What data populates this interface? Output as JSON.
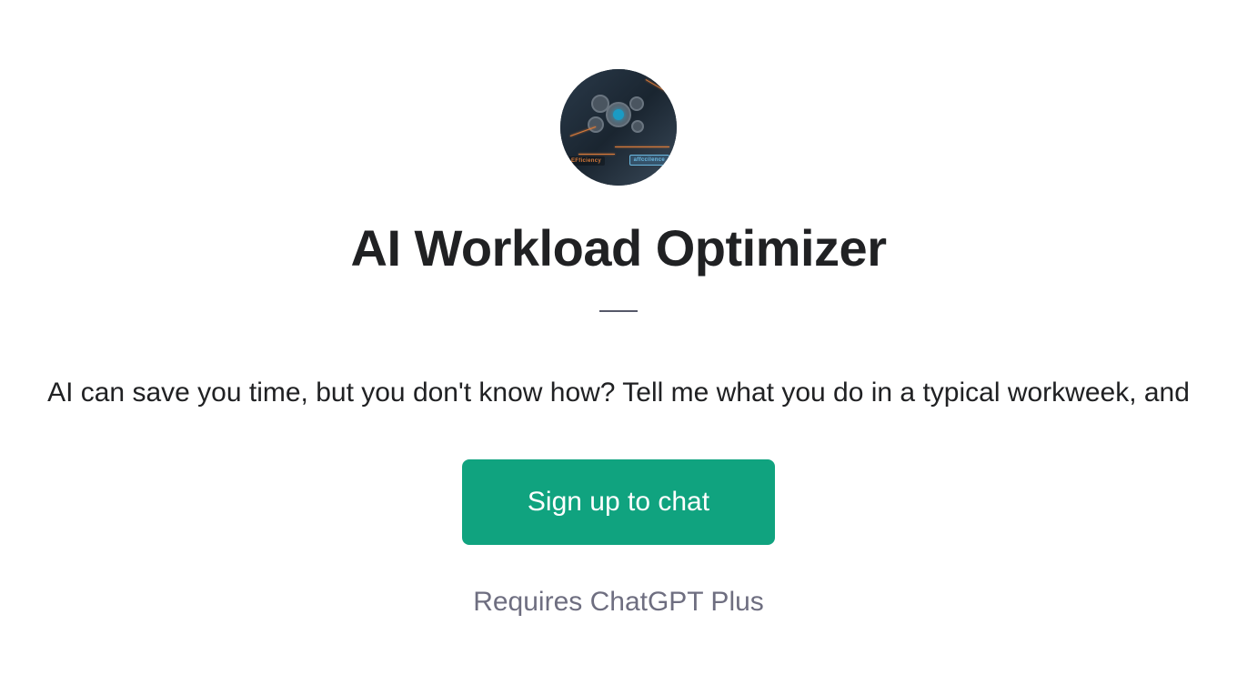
{
  "avatar": {
    "badge_left": "EFficiency",
    "badge_right": "affccilence"
  },
  "title": "AI Workload Optimizer",
  "description": "AI can save you time, but you don't know how? Tell me what you do in a typical workweek, and",
  "cta_label": "Sign up to chat",
  "requires_text": "Requires ChatGPT Plus"
}
